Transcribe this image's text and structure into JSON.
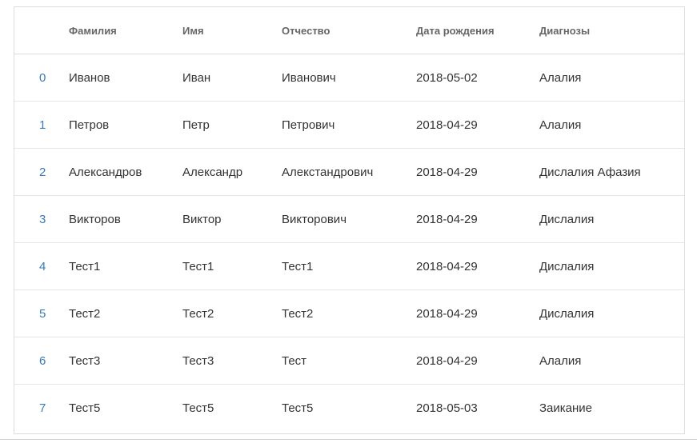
{
  "table": {
    "headers": {
      "index": "",
      "last_name": "Фамилия",
      "first_name": "Имя",
      "middle_name": "Отчество",
      "birth_date": "Дата рождения",
      "diagnoses": "Диагнозы"
    },
    "rows": [
      {
        "index": "0",
        "last_name": "Иванов",
        "first_name": "Иван",
        "middle_name": "Иванович",
        "birth_date": "2018-05-02",
        "diagnoses": "Алалия"
      },
      {
        "index": "1",
        "last_name": "Петров",
        "first_name": "Петр",
        "middle_name": "Петрович",
        "birth_date": "2018-04-29",
        "diagnoses": "Алалия"
      },
      {
        "index": "2",
        "last_name": "Александров",
        "first_name": "Александр",
        "middle_name": "Алекстандрович",
        "birth_date": "2018-04-29",
        "diagnoses": "Дислалия Афазия"
      },
      {
        "index": "3",
        "last_name": "Викторов",
        "first_name": "Виктор",
        "middle_name": "Викторович",
        "birth_date": "2018-04-29",
        "diagnoses": "Дислалия"
      },
      {
        "index": "4",
        "last_name": "Тест1",
        "first_name": "Тест1",
        "middle_name": "Тест1",
        "birth_date": "2018-04-29",
        "diagnoses": "Дислалия"
      },
      {
        "index": "5",
        "last_name": "Тест2",
        "first_name": "Тест2",
        "middle_name": "Тест2",
        "birth_date": "2018-04-29",
        "diagnoses": "Дислалия"
      },
      {
        "index": "6",
        "last_name": "Тест3",
        "first_name": "Тест3",
        "middle_name": "Тест",
        "birth_date": "2018-04-29",
        "diagnoses": "Алалия"
      },
      {
        "index": "7",
        "last_name": "Тест5",
        "first_name": "Тест5",
        "middle_name": "Тест5",
        "birth_date": "2018-05-03",
        "diagnoses": "Заикание"
      }
    ]
  },
  "colors": {
    "link": "#3a7ab8",
    "header_text": "#666666",
    "body_text": "#333333",
    "border": "#dddddd"
  }
}
